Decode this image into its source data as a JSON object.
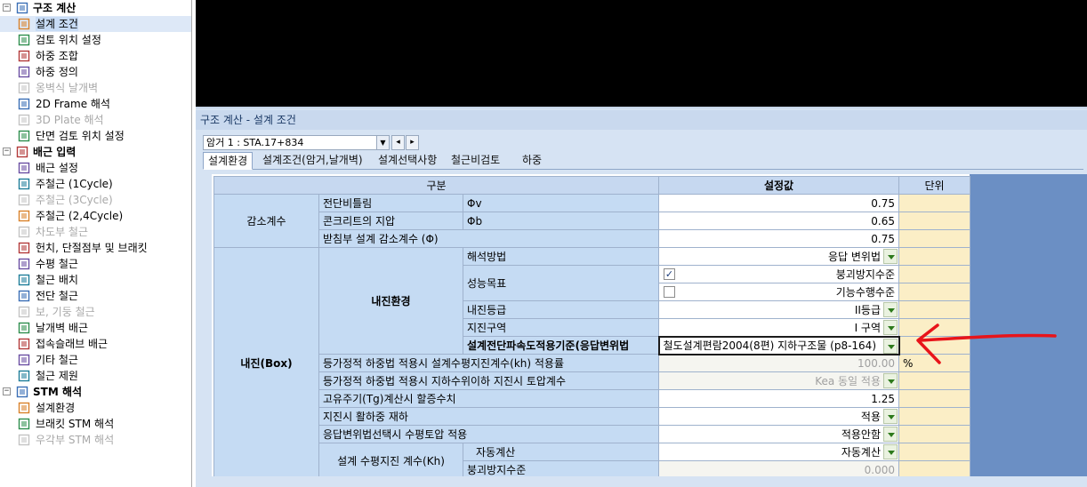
{
  "tree": {
    "items": [
      {
        "label": "구조 계산",
        "level": 0,
        "group": true,
        "icon": "calculator-icon"
      },
      {
        "label": "설계 조건",
        "level": 1,
        "selected": true,
        "icon": "edit-condition-icon"
      },
      {
        "label": "검토 위치 설정",
        "level": 1,
        "icon": "location-icon"
      },
      {
        "label": "하중 조합",
        "level": 1,
        "icon": "load-combination-icon"
      },
      {
        "label": "하중 정의",
        "level": 1,
        "icon": "load-definition-icon"
      },
      {
        "label": "옹벽식 날개벽",
        "level": 1,
        "disabled": true,
        "icon": "wingwall-icon"
      },
      {
        "label": "2D Frame 해석",
        "level": 1,
        "icon": "frame-2d-icon"
      },
      {
        "label": "3D Plate 해석",
        "level": 1,
        "disabled": true,
        "icon": "plate-3d-icon"
      },
      {
        "label": "단면 검토 위치 설정",
        "level": 1,
        "icon": "section-check-icon"
      },
      {
        "label": "배근 입력",
        "level": 0,
        "group": true,
        "icon": "rebar-group-icon"
      },
      {
        "label": "배근 설정",
        "level": 1,
        "icon": "rebar-setting-icon"
      },
      {
        "label": "주철근 (1Cycle)",
        "level": 1,
        "icon": "main-rebar-icon"
      },
      {
        "label": "주철근 (3Cycle)",
        "level": 1,
        "disabled": true,
        "icon": "main-rebar-icon"
      },
      {
        "label": "주철근 (2,4Cycle)",
        "level": 1,
        "icon": "main-rebar-icon"
      },
      {
        "label": "차도부 철근",
        "level": 1,
        "disabled": true,
        "icon": "roadway-rebar-icon"
      },
      {
        "label": "헌치, 단절점부 및 브래킷",
        "level": 1,
        "icon": "haunch-icon"
      },
      {
        "label": "수평 철근",
        "level": 1,
        "icon": "horizontal-rebar-icon"
      },
      {
        "label": "철근 배치",
        "level": 1,
        "icon": "rebar-layout-icon"
      },
      {
        "label": "전단 철근",
        "level": 1,
        "icon": "shear-rebar-icon"
      },
      {
        "label": "보, 기둥 철근",
        "level": 1,
        "disabled": true,
        "icon": "beam-column-icon"
      },
      {
        "label": "날개벽 배근",
        "level": 1,
        "icon": "wingwall-rebar-icon"
      },
      {
        "label": "접속슬래브 배근",
        "level": 1,
        "icon": "approach-slab-icon"
      },
      {
        "label": "기타 철근",
        "level": 1,
        "icon": "misc-rebar-icon"
      },
      {
        "label": "철근 제원",
        "level": 1,
        "icon": "rebar-spec-icon"
      },
      {
        "label": "STM 해석",
        "level": 0,
        "group": true,
        "icon": "stm-group-icon"
      },
      {
        "label": "설계환경",
        "level": 1,
        "icon": "design-env-icon"
      },
      {
        "label": "브래킷 STM 해석",
        "level": 1,
        "icon": "bracket-stm-icon"
      },
      {
        "label": "우각부 STM 해석",
        "level": 1,
        "disabled": true,
        "icon": "corner-stm-icon"
      }
    ]
  },
  "panel": {
    "title": "구조 계산 - 설계 조건",
    "selector_value": "암거 1 : STA.17+834",
    "tabs": [
      "설계환경",
      "설계조건(암거,날개벽)",
      "설계선택사항",
      "철근비검토",
      "하중"
    ],
    "active_tab": 0
  },
  "grid": {
    "header": {
      "category": "구분",
      "value": "설정값",
      "unit": "단위"
    },
    "reduction": {
      "group": "감소계수",
      "rows": [
        {
          "name": "전단비틀림",
          "symbol": "Φv",
          "value": "0.75"
        },
        {
          "name": "콘크리트의 지압",
          "symbol": "Φb",
          "value": "0.65"
        },
        {
          "name": "받침부 설계 감소계수 (Φ)",
          "value": "0.75"
        }
      ]
    },
    "seismic": {
      "group": "내진(Box)",
      "env_group": "내진환경",
      "analysis_method": {
        "label": "해석방법",
        "value": "응답 변위법"
      },
      "performance": {
        "label": "성능목표",
        "options": [
          {
            "label": "붕괴방지수준",
            "checked": true
          },
          {
            "label": "기능수행수준",
            "checked": false
          }
        ]
      },
      "seismic_grade": {
        "label": "내진등급",
        "value": "II등급"
      },
      "seismic_zone": {
        "label": "지진구역",
        "value": "I 구역"
      },
      "spectrum_criteria": {
        "label": "설계전단파속도적용기준(응답변위법",
        "value": "철도설계편람2004(8편) 지하구조물 (p8-164)"
      },
      "rows": [
        {
          "label": "등가정적 하중법 적용시 설계수평지진계수(kh) 적용률",
          "value": "100.00",
          "unit": "%",
          "dim": true
        },
        {
          "label": "등가정적 하중법 적용시 지하수위이하 지진시 토압계수",
          "value": "Kea 동일 적용",
          "dim": true,
          "drop": true
        },
        {
          "label": "고유주기(Tg)계산시 할증수치",
          "value": "1.25"
        },
        {
          "label": "지진시 활하중 재하",
          "value": "적용",
          "drop": true
        },
        {
          "label": "응답변위법선택시 수평토압 적용",
          "value": "적용안함",
          "drop": true
        }
      ],
      "kh": {
        "label": "설계 수평지진 계수(Kh)",
        "sub": [
          {
            "label": "자동계산",
            "value": "자동계산",
            "drop": true
          },
          {
            "label": "붕괴방지수준",
            "value": "0.000",
            "dim": true
          }
        ]
      }
    }
  },
  "colors": {
    "accent": "#6b8fc4",
    "unit_bg": "#fbeec6",
    "header_bg": "#c6d8f0",
    "annotation_arrow": "#e8141a"
  }
}
